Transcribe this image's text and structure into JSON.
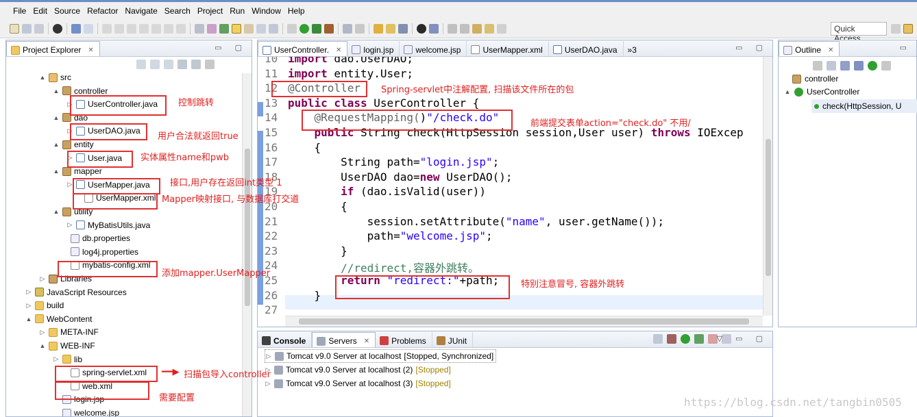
{
  "menu": [
    "File",
    "Edit",
    "Source",
    "Refactor",
    "Navigate",
    "Search",
    "Project",
    "Run",
    "Window",
    "Help"
  ],
  "toolbar": {
    "quick_access": "Quick Access"
  },
  "explorer": {
    "tab": "Project Explorer",
    "tree": [
      {
        "label": "src",
        "icon": "src-folder-icon",
        "arrow": "▲"
      },
      {
        "label": "controller",
        "icon": "package-icon",
        "arrow": "▲"
      },
      {
        "label": "UserController.java",
        "icon": "java-file-icon",
        "arrow": "▷"
      },
      {
        "label": "dao",
        "icon": "package-icon",
        "arrow": "▲"
      },
      {
        "label": "UserDAO.java",
        "icon": "java-file-icon",
        "arrow": "▷"
      },
      {
        "label": "entity",
        "icon": "package-icon",
        "arrow": "▲"
      },
      {
        "label": "User.java",
        "icon": "java-file-icon",
        "arrow": "▷"
      },
      {
        "label": "mapper",
        "icon": "package-icon",
        "arrow": "▲"
      },
      {
        "label": "UserMapper.java",
        "icon": "java-interface-icon",
        "arrow": "▷"
      },
      {
        "label": "UserMapper.xml",
        "icon": "xml-file-icon",
        "arrow": ""
      },
      {
        "label": "utility",
        "icon": "package-icon",
        "arrow": "▲"
      },
      {
        "label": "MyBatisUtils.java",
        "icon": "java-file-icon",
        "arrow": "▷"
      },
      {
        "label": "db.properties",
        "icon": "properties-file-icon",
        "arrow": ""
      },
      {
        "label": "log4j.properties",
        "icon": "properties-file-icon",
        "arrow": ""
      },
      {
        "label": "mybatis-config.xml",
        "icon": "xml-file-icon",
        "arrow": ""
      },
      {
        "label": "Libraries",
        "icon": "library-icon",
        "arrow": "▷"
      },
      {
        "label": "JavaScript Resources",
        "icon": "javascript-resources-icon",
        "arrow": "▷"
      },
      {
        "label": "build",
        "icon": "folder-icon",
        "arrow": "▷"
      },
      {
        "label": "WebContent",
        "icon": "folder-icon",
        "arrow": "▲"
      },
      {
        "label": "META-INF",
        "icon": "folder-icon",
        "arrow": "▷"
      },
      {
        "label": "WEB-INF",
        "icon": "folder-icon",
        "arrow": "▲"
      },
      {
        "label": "lib",
        "icon": "folder-icon",
        "arrow": "▷"
      },
      {
        "label": "spring-servlet.xml",
        "icon": "xml-file-icon",
        "arrow": ""
      },
      {
        "label": "web.xml",
        "icon": "xml-file-icon",
        "arrow": ""
      },
      {
        "label": "login.jsp",
        "icon": "jsp-file-icon",
        "arrow": ""
      },
      {
        "label": "welcome.jsp",
        "icon": "jsp-file-icon",
        "arrow": ""
      }
    ]
  },
  "editor": {
    "tabs": [
      "UserController.",
      "login.jsp",
      "welcome.jsp",
      "UserMapper.xml",
      "UserDAO.java"
    ],
    "overflow": "»3",
    "lines": [
      {
        "n": "10",
        "k": "import",
        "t": " dao.UserDAO;"
      },
      {
        "n": "11",
        "k": "import",
        "t": " entity.User;"
      },
      {
        "n": "12",
        "a": "@Controller"
      },
      {
        "n": "13",
        "k": "public class",
        "t": " UserController {"
      },
      {
        "n": "14",
        "a": "    @RequestMapping(",
        "s": "\"/check.do\"",
        "t": ")"
      },
      {
        "n": "15",
        "k": "    public",
        "t": " String check(HttpSession session,User user) ",
        "k2": "throws",
        "t2": " IOExcep"
      },
      {
        "n": "16",
        "t": "    {"
      },
      {
        "n": "17",
        "t": "        String path=",
        "s": "\"login.jsp\"",
        "t2": ";"
      },
      {
        "n": "18",
        "t": "        UserDAO dao=",
        "k2": "new",
        "t2": " UserDAO();"
      },
      {
        "n": "19",
        "k": "        if",
        "t": " (dao.isValid(user))"
      },
      {
        "n": "20",
        "t": "        {"
      },
      {
        "n": "21",
        "t": "            session.setAttribute(",
        "s": "\"name\"",
        "t2": ", user.getName());"
      },
      {
        "n": "22",
        "t": "            path=",
        "s": "\"welcome.jsp\"",
        "t2": ";"
      },
      {
        "n": "23",
        "t": "        }"
      },
      {
        "n": "24",
        "c": "        //redirect,容器外跳转。"
      },
      {
        "n": "25",
        "k": "        return",
        "s": " \"redirect:\"",
        "t2": "+path;"
      },
      {
        "n": "26",
        "t": "    }"
      },
      {
        "n": "27",
        "t": ""
      }
    ]
  },
  "outline": {
    "tab": "Outline",
    "items": [
      {
        "label": "controller",
        "icon": "package-icon"
      },
      {
        "label": "UserController",
        "icon": "class-icon"
      },
      {
        "label": "check(HttpSession, U",
        "icon": "method-icon"
      }
    ]
  },
  "console": {
    "tabs": [
      "Console",
      "Servers",
      "Problems",
      "JUnit"
    ],
    "servers": [
      {
        "name": "Tomcat v9.0 Server at localhost",
        "state": "[Stopped, Synchronized]"
      },
      {
        "name": "Tomcat v9.0 Server at localhost (2)",
        "state": "[Stopped]"
      },
      {
        "name": "Tomcat v9.0 Server at localhost (3)",
        "state": "[Stopped]"
      }
    ]
  },
  "annotations": {
    "controller_jump": "控制跳转",
    "user_valid": "用户合法就返回true",
    "entity_attr": "实体属性name和pwb",
    "interface": "接口,用户存在返回int类型 1",
    "mapper_xml": "Mapper映射接口, 与数据库打交道",
    "add_mapper": "添加mapper.UserMapper",
    "scan_pkg": "扫描包导入controller",
    "need_config": "需要配置",
    "spring_servlet": "Spring-servlet中注解配置, 扫描该文件所在的包",
    "frontend": "前端提交表单action=\"check.do\" 不用/",
    "colon": "特别注意冒号, 容器外跳转"
  },
  "watermark": "https://blog.csdn.net/tangbin0505"
}
